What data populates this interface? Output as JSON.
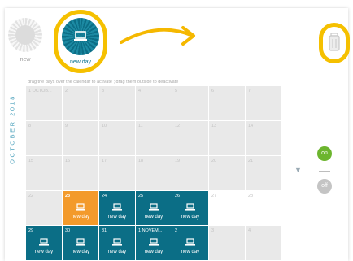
{
  "palette": {
    "new_label": "new",
    "day_label": "new day"
  },
  "hint": "drag the days over the calendar to activate ; drag them outside to deactivate",
  "month_label": "OCTOBER 2018",
  "toggle": {
    "on": "on",
    "off": "off"
  },
  "weeks": [
    [
      {
        "n": "1 OCTOB...",
        "s": "off"
      },
      {
        "n": "2",
        "s": "off"
      },
      {
        "n": "3",
        "s": "off"
      },
      {
        "n": "4",
        "s": "off"
      },
      {
        "n": "5",
        "s": "off"
      },
      {
        "n": "6",
        "s": "off"
      }
    ],
    [
      {
        "n": "8",
        "s": "off"
      },
      {
        "n": "9",
        "s": "off"
      },
      {
        "n": "10",
        "s": "off"
      },
      {
        "n": "11",
        "s": "off"
      },
      {
        "n": "12",
        "s": "off"
      },
      {
        "n": "13",
        "s": "off"
      }
    ],
    [
      {
        "n": "15",
        "s": "off"
      },
      {
        "n": "16",
        "s": "off"
      },
      {
        "n": "17",
        "s": "off"
      },
      {
        "n": "18",
        "s": "off"
      },
      {
        "n": "19",
        "s": "off"
      },
      {
        "n": "20",
        "s": "off"
      }
    ],
    [
      {
        "n": "22",
        "s": "off"
      },
      {
        "n": "23",
        "s": "today",
        "label": "new day"
      },
      {
        "n": "24",
        "s": "day",
        "label": "new day"
      },
      {
        "n": "25",
        "s": "day",
        "label": "new day"
      },
      {
        "n": "26",
        "s": "day",
        "label": "new day"
      },
      {
        "n": "27",
        "s": "blank"
      }
    ],
    [
      {
        "n": "29",
        "s": "day",
        "label": "new day"
      },
      {
        "n": "30",
        "s": "day",
        "label": "new day"
      },
      {
        "n": "31",
        "s": "day",
        "label": "new day"
      },
      {
        "n": "1 NOVEM...",
        "s": "day",
        "label": "new day"
      },
      {
        "n": "2",
        "s": "day",
        "label": "new day"
      },
      {
        "n": "3",
        "s": "off"
      }
    ]
  ],
  "sundays": [
    "7",
    "14",
    "21",
    "28",
    "4"
  ]
}
